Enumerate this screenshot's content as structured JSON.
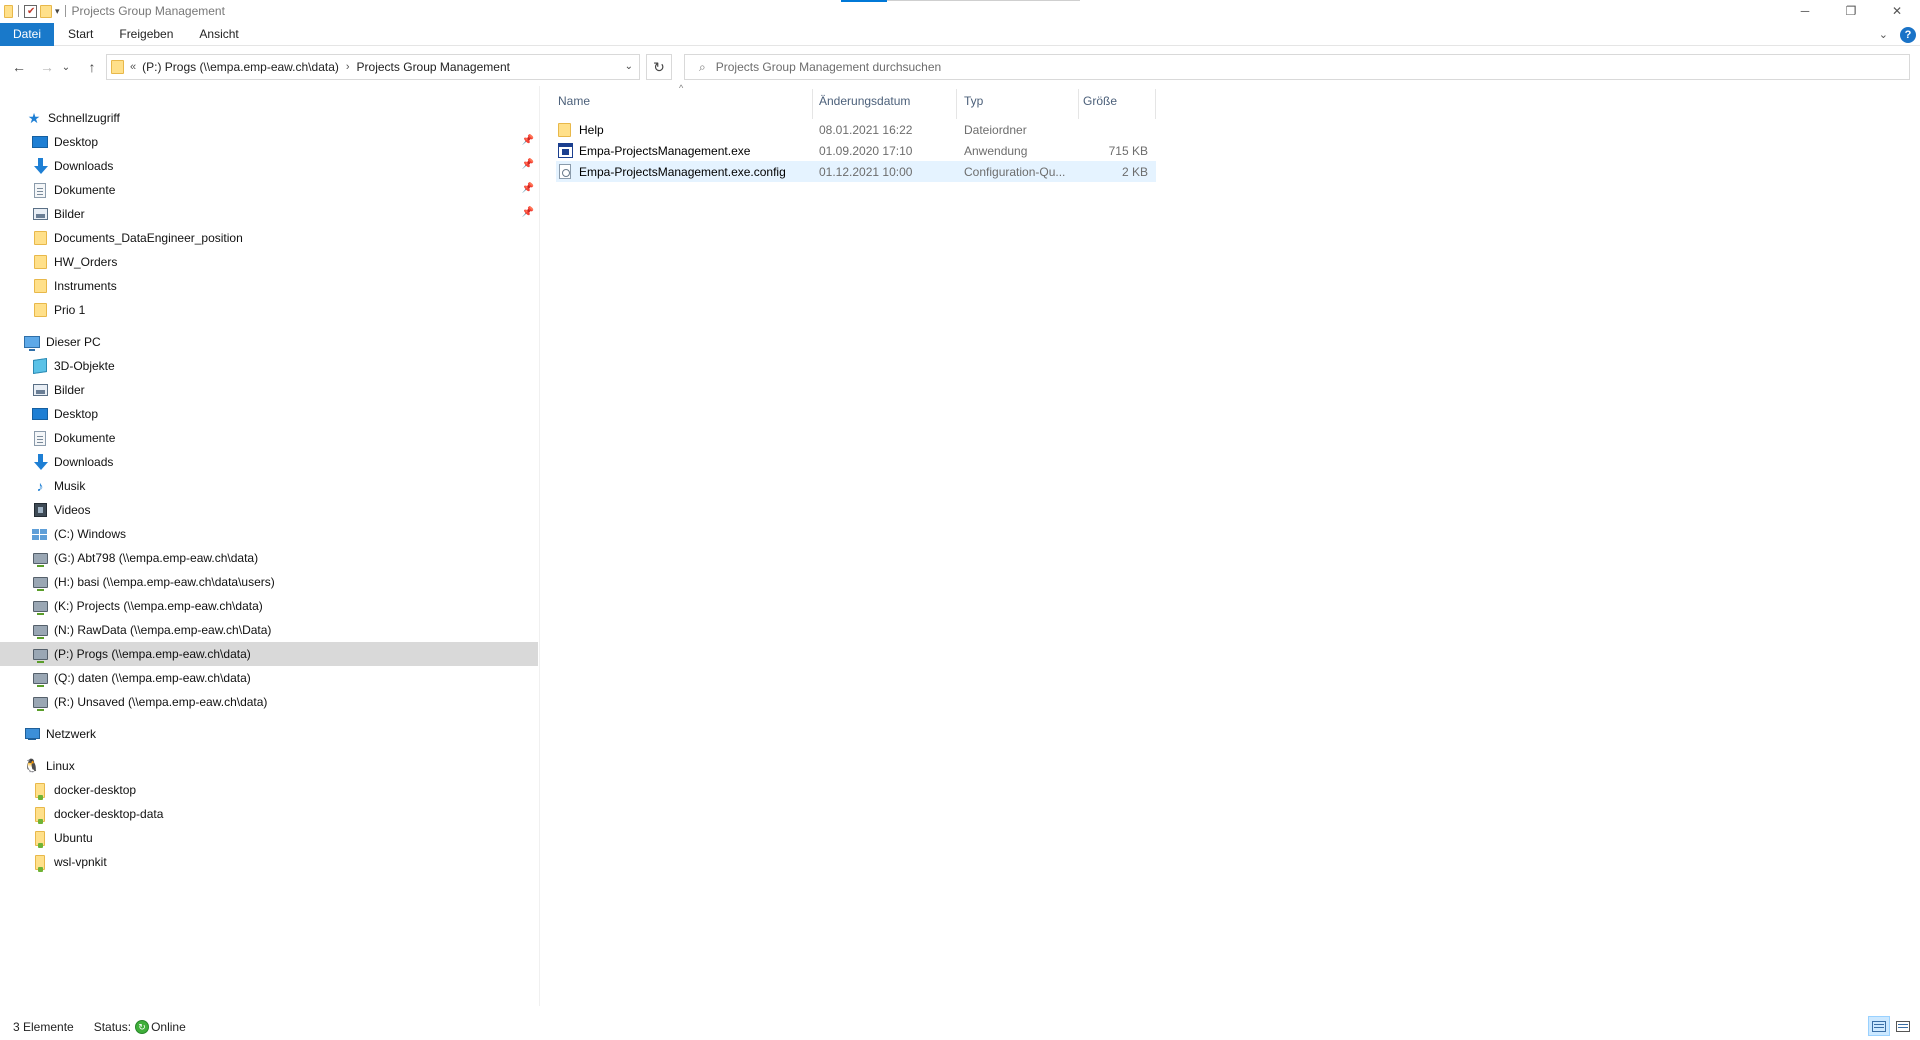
{
  "window": {
    "title": "Projects Group Management",
    "controls": {
      "minimize": "─",
      "maximize": "❐",
      "close": "✕"
    }
  },
  "ribbon": {
    "tabs": [
      {
        "label": "Datei",
        "active": true
      },
      {
        "label": "Start"
      },
      {
        "label": "Freigeben"
      },
      {
        "label": "Ansicht"
      }
    ],
    "help": "?"
  },
  "nav": {
    "back": "←",
    "forward": "→",
    "recent": "⌄",
    "up": "↑",
    "refresh": "↻"
  },
  "address": {
    "overflow": "«",
    "crumbs": [
      "(P:) Progs (\\\\empa.emp-eaw.ch\\data)",
      "Projects Group Management"
    ],
    "separator": "›"
  },
  "search": {
    "placeholder": "Projects Group Management durchsuchen"
  },
  "sidebar": {
    "quick_access": {
      "label": "Schnellzugriff",
      "items": [
        {
          "label": "Desktop",
          "icon": "desktop-icon",
          "pinned": true
        },
        {
          "label": "Downloads",
          "icon": "downloads-icon",
          "pinned": true
        },
        {
          "label": "Dokumente",
          "icon": "documents-icon",
          "pinned": true
        },
        {
          "label": "Bilder",
          "icon": "pictures-icon",
          "pinned": true
        },
        {
          "label": "Documents_DataEngineer_position",
          "icon": "folder-icon"
        },
        {
          "label": "HW_Orders",
          "icon": "folder-icon"
        },
        {
          "label": "Instruments",
          "icon": "folder-icon"
        },
        {
          "label": "Prio 1",
          "icon": "folder-icon"
        }
      ]
    },
    "this_pc": {
      "label": "Dieser PC",
      "items": [
        {
          "label": "3D-Objekte",
          "icon": "3d-objects-icon"
        },
        {
          "label": "Bilder",
          "icon": "pictures-icon"
        },
        {
          "label": "Desktop",
          "icon": "desktop-icon"
        },
        {
          "label": "Dokumente",
          "icon": "documents-icon"
        },
        {
          "label": "Downloads",
          "icon": "downloads-icon"
        },
        {
          "label": "Musik",
          "icon": "music-icon"
        },
        {
          "label": "Videos",
          "icon": "videos-icon"
        },
        {
          "label": "(C:) Windows",
          "icon": "windows-drive-icon"
        },
        {
          "label": "(G:) Abt798 (\\\\empa.emp-eaw.ch\\data)",
          "icon": "network-drive-icon"
        },
        {
          "label": "(H:) basi (\\\\empa.emp-eaw.ch\\data\\users)",
          "icon": "network-drive-icon"
        },
        {
          "label": "(K:) Projects (\\\\empa.emp-eaw.ch\\data)",
          "icon": "network-drive-icon"
        },
        {
          "label": "(N:) RawData (\\\\empa.emp-eaw.ch\\Data)",
          "icon": "network-drive-icon"
        },
        {
          "label": "(P:) Progs (\\\\empa.emp-eaw.ch\\data)",
          "icon": "network-drive-icon",
          "selected": true
        },
        {
          "label": "(Q:) daten (\\\\empa.emp-eaw.ch\\data)",
          "icon": "network-drive-icon"
        },
        {
          "label": "(R:) Unsaved (\\\\empa.emp-eaw.ch\\data)",
          "icon": "network-drive-icon"
        }
      ]
    },
    "network": {
      "label": "Netzwerk"
    },
    "linux": {
      "label": "Linux",
      "items": [
        {
          "label": "docker-desktop"
        },
        {
          "label": "docker-desktop-data"
        },
        {
          "label": "Ubuntu"
        },
        {
          "label": "wsl-vpnkit"
        }
      ]
    },
    "pin_glyph": "📌"
  },
  "files": {
    "columns": {
      "name": "Name",
      "date": "Änderungsdatum",
      "type": "Typ",
      "size": "Größe",
      "sort_caret": "^"
    },
    "rows": [
      {
        "name": "Help",
        "date": "08.01.2021 16:22",
        "type": "Dateiordner",
        "size": "",
        "icon": "folder-icon"
      },
      {
        "name": "Empa-ProjectsManagement.exe",
        "date": "01.09.2020 17:10",
        "type": "Anwendung",
        "size": "715 KB",
        "icon": "exe-icon"
      },
      {
        "name": "Empa-ProjectsManagement.exe.config",
        "date": "01.12.2021 10:00",
        "type": "Configuration-Qu...",
        "size": "2 KB",
        "icon": "config-file-icon",
        "selected": true
      }
    ]
  },
  "status": {
    "count": "3 Elemente",
    "status_label": "Status:",
    "status_value": "Online"
  }
}
